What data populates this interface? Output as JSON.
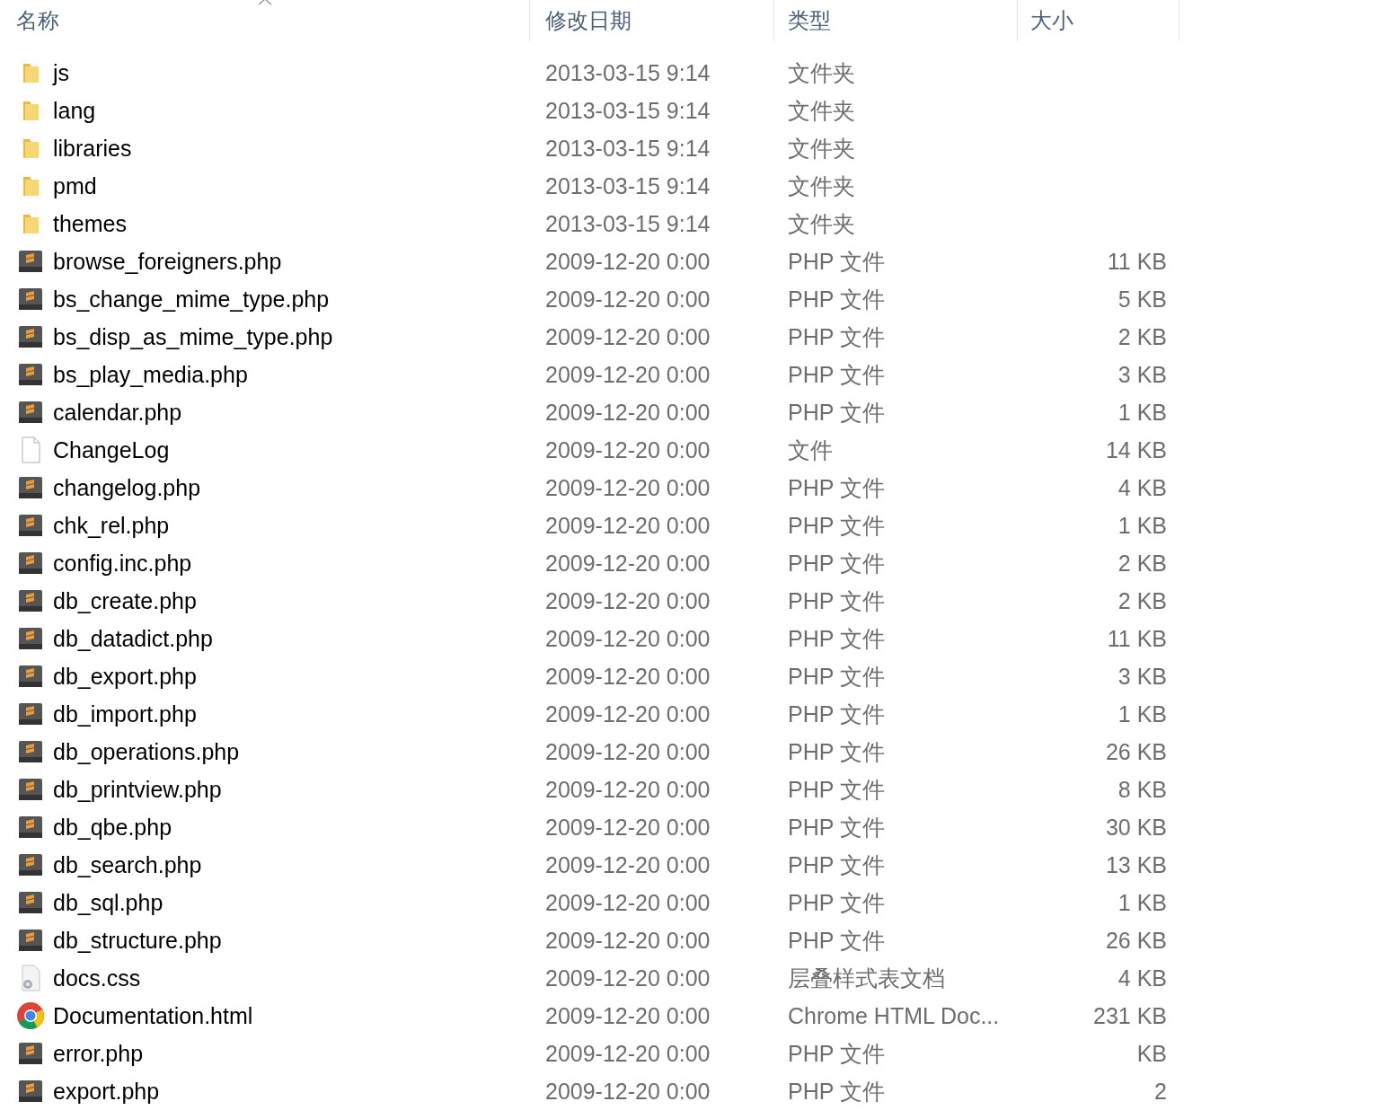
{
  "columns": [
    {
      "label": "名称",
      "sorted": true
    },
    {
      "label": "修改日期",
      "sorted": false
    },
    {
      "label": "类型",
      "sorted": false
    },
    {
      "label": "大小",
      "sorted": false
    }
  ],
  "rows": [
    {
      "kind": "folder",
      "name": "js",
      "date": "2013-03-15 9:14",
      "type": "文件夹"
    },
    {
      "kind": "folder",
      "name": "lang",
      "date": "2013-03-15 9:14",
      "type": "文件夹"
    },
    {
      "kind": "folder",
      "name": "libraries",
      "date": "2013-03-15 9:14",
      "type": "文件夹"
    },
    {
      "kind": "folder",
      "name": "pmd",
      "date": "2013-03-15 9:14",
      "type": "文件夹"
    },
    {
      "kind": "folder",
      "name": "themes",
      "date": "2013-03-15 9:14",
      "type": "文件夹"
    },
    {
      "kind": "php",
      "name": "browse_foreigners.php",
      "date": "2009-12-20 0:00",
      "type": "PHP 文件",
      "size": "11 KB"
    },
    {
      "kind": "php",
      "name": "bs_change_mime_type.php",
      "date": "2009-12-20 0:00",
      "type": "PHP 文件",
      "size": "5 KB"
    },
    {
      "kind": "php",
      "name": "bs_disp_as_mime_type.php",
      "date": "2009-12-20 0:00",
      "type": "PHP 文件",
      "size": "2 KB"
    },
    {
      "kind": "php",
      "name": "bs_play_media.php",
      "date": "2009-12-20 0:00",
      "type": "PHP 文件",
      "size": "3 KB"
    },
    {
      "kind": "php",
      "name": "calendar.php",
      "date": "2009-12-20 0:00",
      "type": "PHP 文件",
      "size": "1 KB"
    },
    {
      "kind": "file",
      "name": "ChangeLog",
      "date": "2009-12-20 0:00",
      "type": "文件",
      "size": "14 KB"
    },
    {
      "kind": "php",
      "name": "changelog.php",
      "date": "2009-12-20 0:00",
      "type": "PHP 文件",
      "size": "4 KB"
    },
    {
      "kind": "php",
      "name": "chk_rel.php",
      "date": "2009-12-20 0:00",
      "type": "PHP 文件",
      "size": "1 KB"
    },
    {
      "kind": "php",
      "name": "config.inc.php",
      "date": "2009-12-20 0:00",
      "type": "PHP 文件",
      "size": "2 KB"
    },
    {
      "kind": "php",
      "name": "db_create.php",
      "date": "2009-12-20 0:00",
      "type": "PHP 文件",
      "size": "2 KB"
    },
    {
      "kind": "php",
      "name": "db_datadict.php",
      "date": "2009-12-20 0:00",
      "type": "PHP 文件",
      "size": "11 KB"
    },
    {
      "kind": "php",
      "name": "db_export.php",
      "date": "2009-12-20 0:00",
      "type": "PHP 文件",
      "size": "3 KB"
    },
    {
      "kind": "php",
      "name": "db_import.php",
      "date": "2009-12-20 0:00",
      "type": "PHP 文件",
      "size": "1 KB"
    },
    {
      "kind": "php",
      "name": "db_operations.php",
      "date": "2009-12-20 0:00",
      "type": "PHP 文件",
      "size": "26 KB"
    },
    {
      "kind": "php",
      "name": "db_printview.php",
      "date": "2009-12-20 0:00",
      "type": "PHP 文件",
      "size": "8 KB"
    },
    {
      "kind": "php",
      "name": "db_qbe.php",
      "date": "2009-12-20 0:00",
      "type": "PHP 文件",
      "size": "30 KB"
    },
    {
      "kind": "php",
      "name": "db_search.php",
      "date": "2009-12-20 0:00",
      "type": "PHP 文件",
      "size": "13 KB"
    },
    {
      "kind": "php",
      "name": "db_sql.php",
      "date": "2009-12-20 0:00",
      "type": "PHP 文件",
      "size": "1 KB"
    },
    {
      "kind": "php",
      "name": "db_structure.php",
      "date": "2009-12-20 0:00",
      "type": "PHP 文件",
      "size": "26 KB"
    },
    {
      "kind": "css",
      "name": "docs.css",
      "date": "2009-12-20 0:00",
      "type": "层叠样式表文档",
      "size": "4 KB"
    },
    {
      "kind": "chrome",
      "name": "Documentation.html",
      "date": "2009-12-20 0:00",
      "type": "Chrome HTML Doc...",
      "size": "231 KB"
    },
    {
      "kind": "php",
      "name": "error.php",
      "date": "2009-12-20 0:00",
      "type": "PHP 文件",
      "size": "KB"
    },
    {
      "kind": "php",
      "name": "export.php",
      "date": "2009-12-20 0:00",
      "type": "PHP 文件",
      "size": "2"
    }
  ]
}
